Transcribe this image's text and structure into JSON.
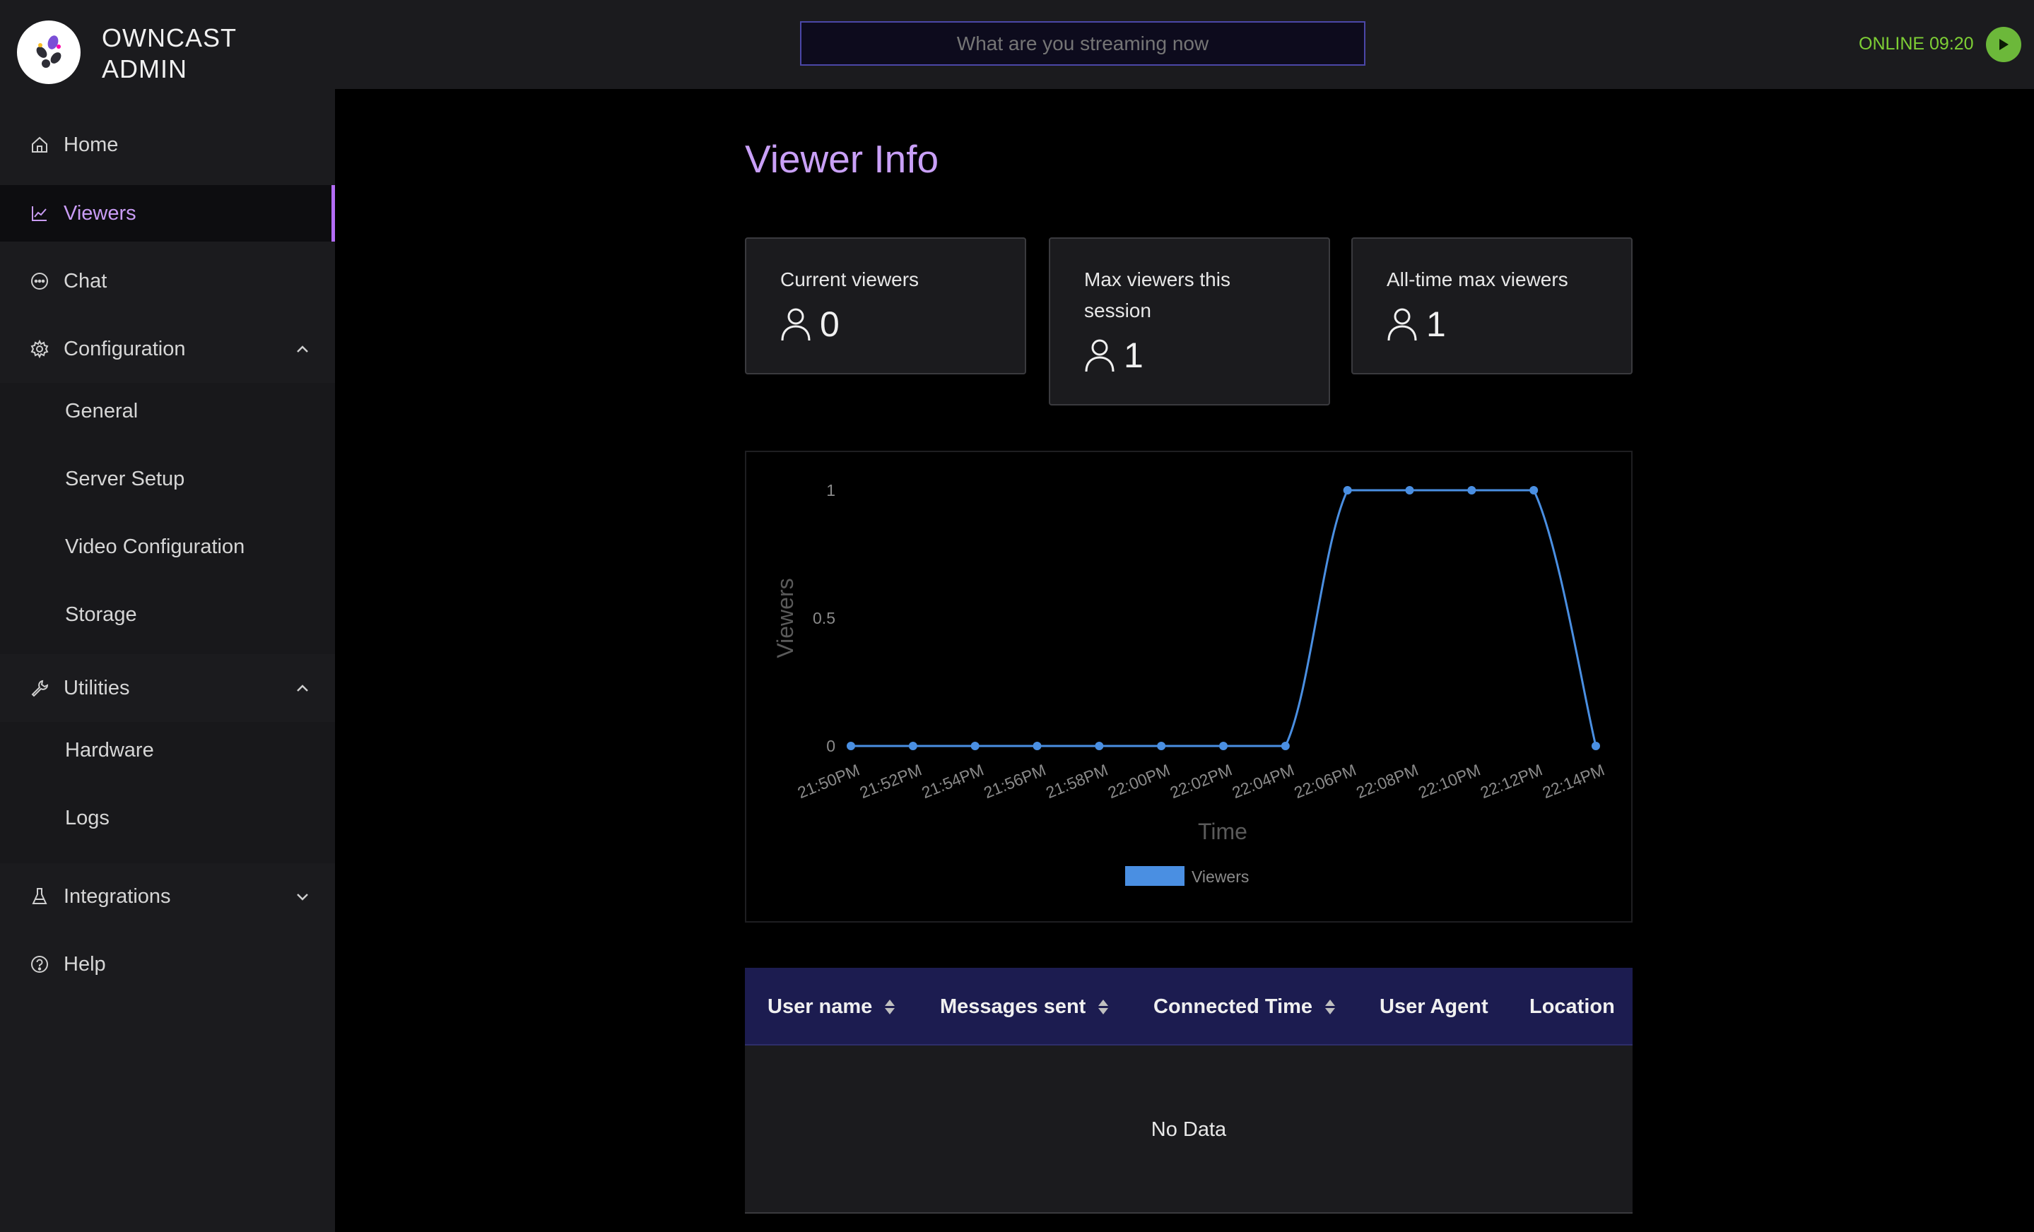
{
  "header": {
    "brand_line1": "OWNCAST",
    "brand_line2": "ADMIN",
    "stream_title_placeholder": "What are you streaming now",
    "status": "ONLINE 09:20",
    "status_color": "#7ecf35"
  },
  "sidebar": {
    "items": [
      {
        "label": "Home",
        "icon": "home-icon"
      },
      {
        "label": "Viewers",
        "icon": "line-chart-icon",
        "active": true
      },
      {
        "label": "Chat",
        "icon": "chat-bubble-icon"
      },
      {
        "label": "Configuration",
        "icon": "gear-icon",
        "expanded": true
      },
      {
        "label": "Utilities",
        "icon": "wrench-icon",
        "expanded": true
      },
      {
        "label": "Integrations",
        "icon": "flask-icon",
        "expanded": false
      },
      {
        "label": "Help",
        "icon": "question-circle-icon"
      }
    ],
    "configuration_children": [
      "General",
      "Server Setup",
      "Video Configuration",
      "Storage"
    ],
    "utilities_children": [
      "Hardware",
      "Logs"
    ]
  },
  "main": {
    "title": "Viewer Info",
    "stats": [
      {
        "title": "Current viewers",
        "value": "0"
      },
      {
        "title_line1": "Max viewers this",
        "title_line2": "session",
        "value": "1"
      },
      {
        "title": "All-time max viewers",
        "value": "1"
      }
    ],
    "table": {
      "columns": [
        "User name",
        "Messages sent",
        "Connected Time",
        "User Agent",
        "Location"
      ],
      "empty_text": "No Data"
    }
  },
  "chart_data": {
    "type": "line",
    "x": [
      "21:50PM",
      "21:52PM",
      "21:54PM",
      "21:56PM",
      "21:58PM",
      "22:00PM",
      "22:02PM",
      "22:04PM",
      "22:06PM",
      "22:08PM",
      "22:10PM",
      "22:12PM",
      "22:14PM"
    ],
    "series": [
      {
        "name": "Viewers",
        "values": [
          0,
          0,
          0,
          0,
          0,
          0,
          0,
          0,
          1,
          1,
          1,
          1,
          0
        ],
        "color": "#4a8fe2"
      }
    ],
    "xlabel": "Time",
    "ylabel": "Viewers",
    "yticks": [
      "0",
      "0.5",
      "1"
    ],
    "ylim": [
      0,
      1
    ],
    "legend": "bottom-center"
  }
}
